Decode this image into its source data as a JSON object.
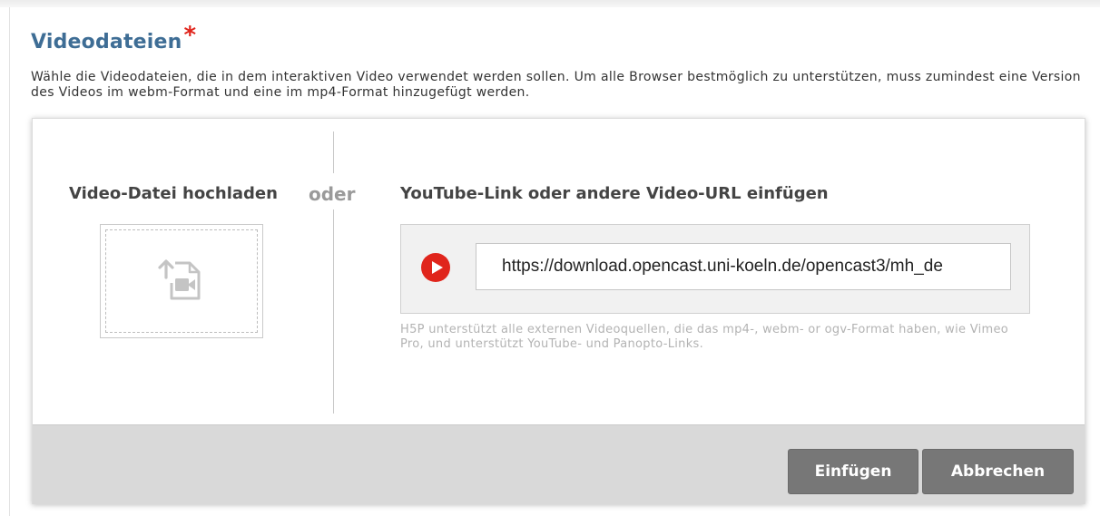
{
  "field": {
    "title": "Videodateien",
    "required_marker": "*",
    "description": "Wähle die Videodateien, die in dem interaktiven Video verwendet werden sollen. Um alle Browser bestmöglich zu unterstützen, muss zumindest eine Version des Videos im webm-Format und eine im mp4-Format hinzugefügt werden."
  },
  "dialog": {
    "upload": {
      "heading": "Video-Datei hochladen",
      "icon": "file-upload-video-icon"
    },
    "separator": "oder",
    "url": {
      "heading": "YouTube-Link oder andere Video-URL einfügen",
      "icon": "youtube-play-icon",
      "value": "https://download.opencast.uni-koeln.de/opencast3/mh_de",
      "help": "H5P unterstützt alle externen Videoquellen, die das mp4-, webm- or ogv-Format haben, wie Vimeo Pro, und unterstützt YouTube- und Panopto-Links."
    },
    "buttons": {
      "insert": "Einfügen",
      "cancel": "Abbrechen"
    }
  },
  "colors": {
    "title": "#3e6d95",
    "required": "#e0251c",
    "button": "#777777",
    "footer": "#d9d9d9",
    "youtube": "#e0251c"
  }
}
